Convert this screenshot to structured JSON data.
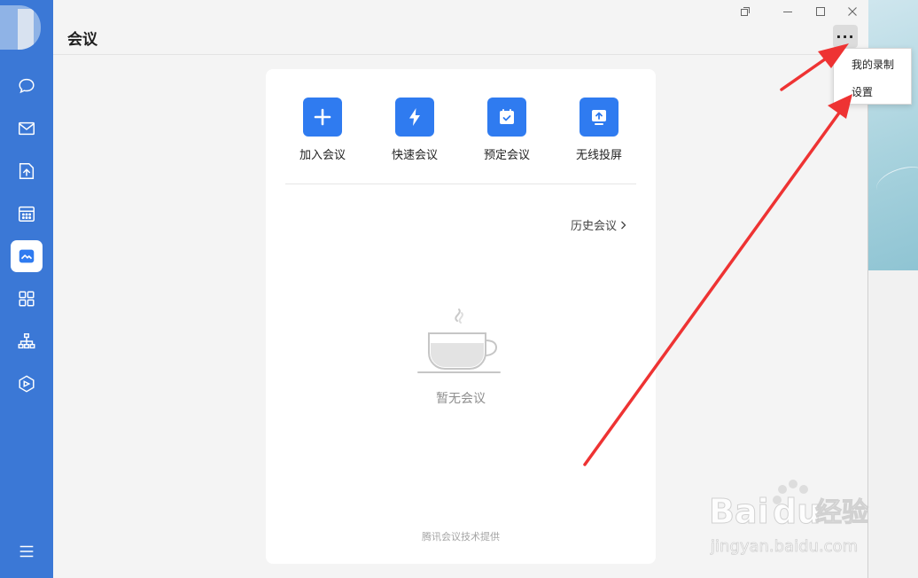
{
  "window": {
    "title": "会议"
  },
  "sidebar": {
    "items": [
      {
        "icon": "chat-icon"
      },
      {
        "icon": "mail-icon"
      },
      {
        "icon": "docs-icon"
      },
      {
        "icon": "calendar-icon"
      },
      {
        "icon": "meeting-icon",
        "active": true
      },
      {
        "icon": "apps-icon"
      },
      {
        "icon": "org-chart-icon"
      },
      {
        "icon": "cube-icon"
      },
      {
        "icon": "menu-icon"
      }
    ]
  },
  "toolbar": {
    "more_label": "···"
  },
  "menu": {
    "items": [
      {
        "label": "我的录制"
      },
      {
        "label": "设置"
      }
    ]
  },
  "actions": [
    {
      "label": "加入会议",
      "icon": "plus-icon"
    },
    {
      "label": "快速会议",
      "icon": "lightning-icon"
    },
    {
      "label": "预定会议",
      "icon": "calendar-check-icon"
    },
    {
      "label": "无线投屏",
      "icon": "screen-share-icon"
    }
  ],
  "history": {
    "label": "历史会议"
  },
  "empty_state": {
    "text": "暂无会议",
    "icon": "coffee-cup-icon"
  },
  "footer": {
    "text": "腾讯会议技术提供"
  },
  "watermark": {
    "brand": "Baidu经验",
    "url": "jingyan.baidu.com"
  },
  "colors": {
    "sidebar": "#3b78d6",
    "accent": "#2f7bf0",
    "arrow": "#ee3333"
  }
}
